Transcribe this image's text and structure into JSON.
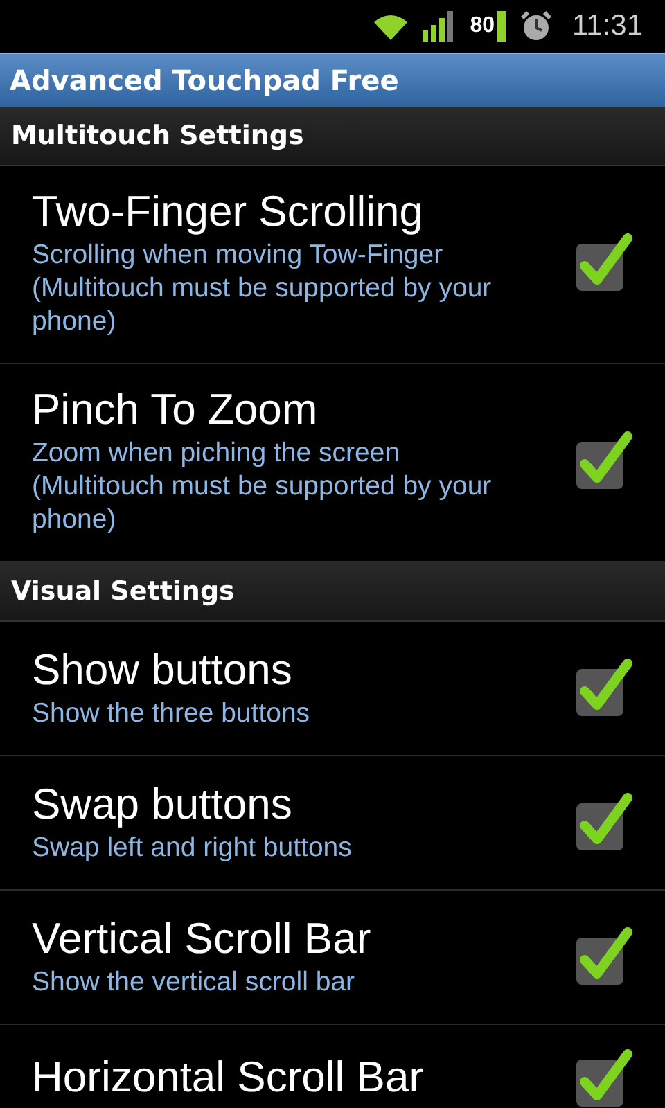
{
  "status_bar": {
    "battery": "80",
    "time": "11:31"
  },
  "title_bar": {
    "title": "Advanced Touchpad Free"
  },
  "sections": [
    {
      "title": "Multitouch Settings",
      "items": [
        {
          "title": "Two-Finger Scrolling",
          "summary": "Scrolling when moving Tow-Finger (Multitouch must be supported by your phone)",
          "checked": true
        },
        {
          "title": "Pinch To Zoom",
          "summary": "Zoom when piching the screen (Multitouch must be supported by your phone)",
          "checked": true
        }
      ]
    },
    {
      "title": "Visual Settings",
      "items": [
        {
          "title": "Show buttons",
          "summary": "Show the three buttons",
          "checked": true
        },
        {
          "title": "Swap buttons",
          "summary": "Swap left and right buttons",
          "checked": true
        },
        {
          "title": "Vertical Scroll Bar",
          "summary": "Show the vertical scroll bar",
          "checked": true
        },
        {
          "title": "Horizontal Scroll Bar",
          "checked": true
        }
      ]
    }
  ]
}
